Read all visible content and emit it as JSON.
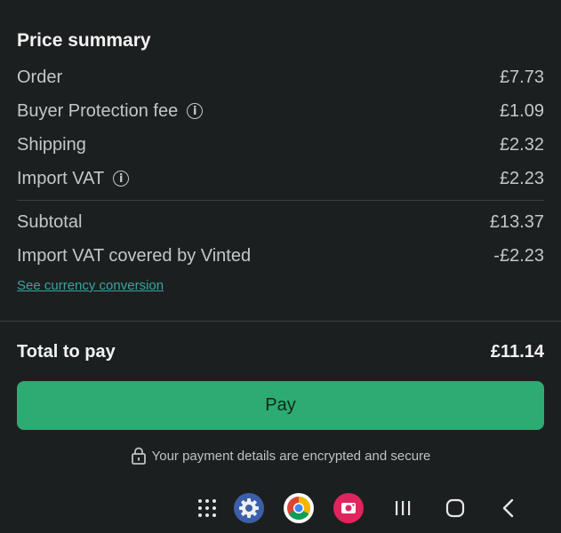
{
  "summary": {
    "title": "Price summary",
    "rows": [
      {
        "label": "Order",
        "value": "£7.73"
      },
      {
        "label": "Buyer Protection fee",
        "value": "£1.09",
        "info": true
      },
      {
        "label": "Shipping",
        "value": "£2.32"
      },
      {
        "label": "Import VAT",
        "value": "£2.23",
        "info": true
      }
    ],
    "subtotal": {
      "label": "Subtotal",
      "value": "£13.37"
    },
    "vat_covered": {
      "label": "Import VAT covered by Vinted",
      "value": "-£2.23"
    },
    "currency_link": "See currency conversion"
  },
  "total": {
    "label": "Total to pay",
    "value": "£11.14"
  },
  "pay_button": {
    "label": "Pay"
  },
  "secure_note": "Your payment details are encrypted and secure",
  "navbar": {
    "icons": [
      "apps-grid-icon",
      "settings-app-icon",
      "chrome-app-icon",
      "screen-recorder-app-icon",
      "recents-icon",
      "home-icon",
      "back-icon"
    ]
  },
  "colors": {
    "background": "#1c1f1f",
    "pay_button": "#2dab72",
    "link": "#3aa3a0"
  }
}
